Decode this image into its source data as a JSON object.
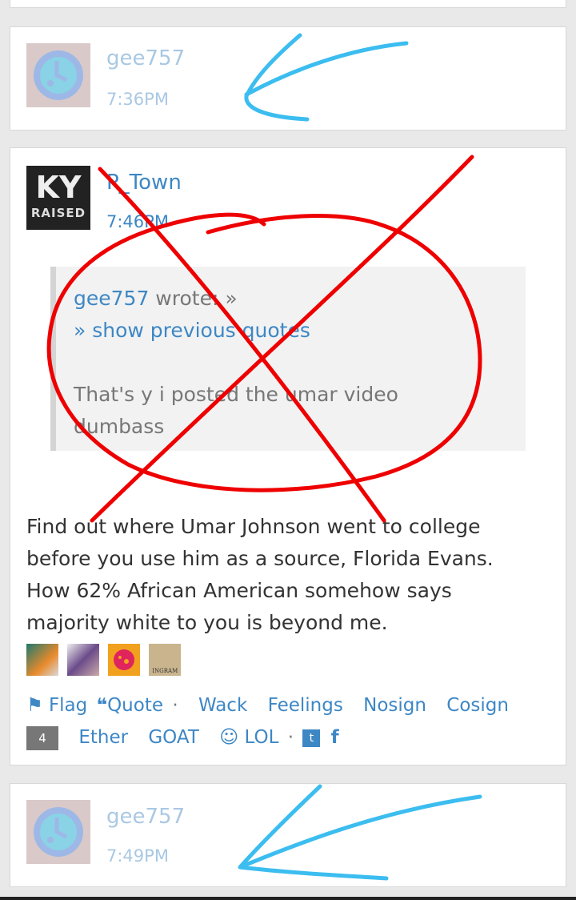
{
  "post1": {
    "username": "gee757",
    "time": "7:36PM"
  },
  "post2": {
    "username": "P_Town",
    "time": "7:46PM",
    "avatar_text_top": "KY",
    "avatar_text_bottom": "RAISED",
    "quote": {
      "author": "gee757",
      "wrote_label": " wrote: »",
      "show_previous": "» show previous quotes",
      "text_line1": "That's y i posted the umar video",
      "text_line2": "dumbass"
    },
    "body_lines": [
      "Find out where Umar Johnson went to college",
      "before you use him as a source, Florida Evans.",
      "How 62% African American somehow says",
      "majority white to you is beyond me."
    ],
    "reaction_tag": "INGRAM",
    "actions": {
      "flag": "Flag",
      "quote": "Quote",
      "dot": "·",
      "wack": "Wack",
      "feelings": "Feelings",
      "nosign": "Nosign",
      "cosign": "Cosign",
      "count": "4",
      "ether": "Ether",
      "goat": "GOAT",
      "lol": "LOL",
      "f": "f"
    }
  },
  "post3": {
    "username": "gee757",
    "time": "7:49PM"
  },
  "colors": {
    "link": "#3d87c5",
    "faded_link": "#a9c8e3",
    "red_annotation": "#ee0000",
    "blue_annotation": "#3cbdf0"
  }
}
